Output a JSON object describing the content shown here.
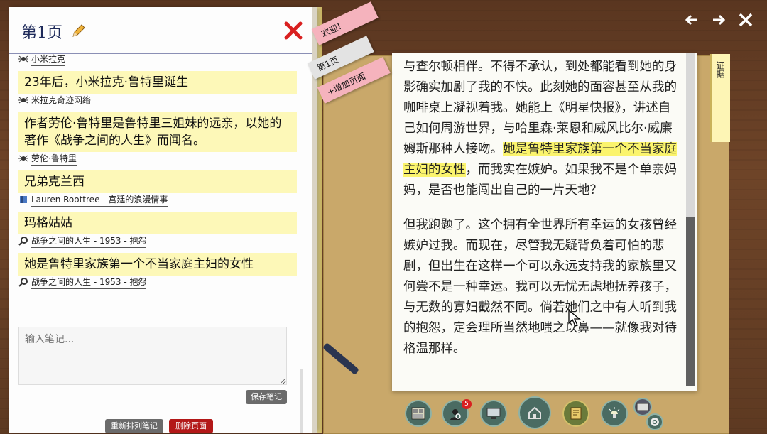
{
  "nav": {
    "back_icon": "arrow-left-icon",
    "forward_icon": "arrow-right-icon",
    "close_icon": "close-icon"
  },
  "notebook": {
    "title": "第1页",
    "notes": [
      {
        "source_icon": "spider-icon",
        "source": "小米拉克",
        "text": ""
      },
      {
        "source_icon": "spider-icon",
        "source": "米拉克奇迹网络",
        "text": "23年后，小米拉克·鲁特里诞生"
      },
      {
        "source_icon": "spider-icon",
        "source": "劳伦·鲁特里",
        "text": "作者劳伦·鲁特里是鲁特里三姐妹的远亲，以她的著作《战争之间的人生》而闻名。"
      },
      {
        "source_icon": "book-icon",
        "source": "Lauren Roottree - 宫廷的浪漫情事",
        "text": "兄弟克兰西"
      },
      {
        "source_icon": "magnifier-icon",
        "source": "战争之间的人生 - 1953 - 抱怨",
        "text": "玛格姑姑"
      },
      {
        "source_icon": "magnifier-icon",
        "source": "战争之间的人生 - 1953 - 抱怨",
        "text": "她是鲁特里家族第一个不当家庭主妇的女性"
      }
    ],
    "input_placeholder": "输入笔记...",
    "save_label": "保存笔记",
    "sort_label": "重新排列笔记",
    "delete_label": "删除页面"
  },
  "tabs": {
    "welcome": "欢迎！",
    "page1": "第1页",
    "add": "+增加页面"
  },
  "folder_tab": "证据",
  "document": {
    "para1_a": "与查尔顿相伴。不得不承认，到处都能看到她的身影确实加剧了我的不快。此刻她的面容甚至从我的咖啡桌上凝视着我。她能上《明星快报》，讲述自己如何周游世界，与哈里森·莱恩和威风比尔·威廉姆斯那种人接吻。",
    "para1_hl": "她是鲁特里家族第一个不当家庭主妇的女性",
    "para1_b": "，而我实在嫉妒。如果我不是个单亲妈妈，是否也能闯出自己的一片天地？",
    "para2": "但我跑题了。这个拥有全世界所有幸运的女孩曾经嫉妒过我。而现在，尽管我无疑背负着可怕的悲剧，但出生在这样一个可以永远支持我的家族里又何尝不是一种幸运。我可以无忧无虑地抚养孩子，与无数的寡妇截然不同。倘若她们之中有人听到我的抱怨，定会理所当然地嗤之以鼻——就像我对待格温那样。"
  },
  "toolbar": {
    "items": [
      "evidence-board-icon",
      "detective-icon",
      "computer-icon",
      "home-icon",
      "notebook-icon",
      "lamp-icon",
      "settings-icon"
    ],
    "badge_count": "5"
  },
  "colors": {
    "highlight": "#fbf46d",
    "note_bg": "#fdf8b8",
    "delete": "#b31818",
    "tab_pink": "#f5b3bd"
  }
}
